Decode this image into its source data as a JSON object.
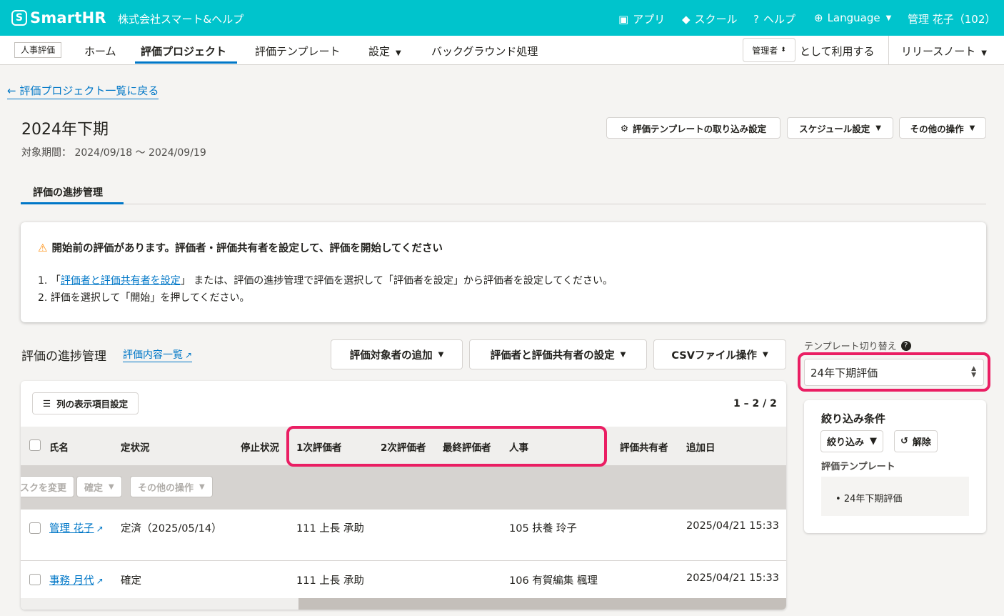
{
  "header": {
    "logo_mark": "S",
    "logo_text": "SmartHR",
    "company": "株式会社スマート&ヘルプ",
    "apps": "アプリ",
    "school": "スクール",
    "help": "ヘルプ",
    "language": "Language",
    "user": "管理 花子（102）"
  },
  "nav": {
    "badge": "人事評価",
    "home": "ホーム",
    "projects": "評価プロジェクト",
    "templates": "評価テンプレート",
    "settings": "設定",
    "background": "バックグラウンド処理",
    "role": "管理者",
    "role_suffix": "として利用する",
    "release_notes": "リリースノート"
  },
  "page": {
    "back_link": "評価プロジェクト一覧に戻る",
    "title": "2024年下期",
    "period_label": "対象期間：",
    "period_value": "2024/09/18 〜 2024/09/19",
    "btn_template_import": "評価テンプレートの取り込み設定",
    "btn_schedule": "スケジュール設定",
    "btn_other": "その他の操作",
    "tab": "評価の進捗管理"
  },
  "alert": {
    "title": "開始前の評価があります。評価者・評価共有者を設定して、評価を開始してください",
    "line1_prefix": "1. 「",
    "line1_link": "評価者と評価共有者を設定",
    "line1_suffix": "」 または、評価の進捗管理で評価を選択して「評価者を設定」から評価者を設定してください。",
    "line2": "2. 評価を選択して「開始」を押してください。"
  },
  "section": {
    "title": "評価の進捗管理",
    "link": "評価内容一覧",
    "btn_add": "評価対象者の追加",
    "btn_evaluators": "評価者と評価共有者の設定",
    "btn_csv": "CSVファイル操作",
    "template_label": "テンプレート切り替え",
    "template_value": "24年下期評価"
  },
  "table": {
    "columns_btn": "列の表示項目設定",
    "count": "1 – 2 / 2",
    "headers": [
      "氏名",
      "定状況",
      "停止状況",
      "1次評価者",
      "2次評価者",
      "最終評価者",
      "人事",
      "評価共有者",
      "追加日"
    ],
    "bulk": [
      "スクを変更",
      "確定",
      "その他の操作"
    ],
    "rows": [
      {
        "name": "管理 花子",
        "status": "定済（2025/05/14）",
        "eval1": "111 上長 承助",
        "hr": "105 扶養 玲子",
        "date": "2025/04/21 15:33"
      },
      {
        "name": "事務 月代",
        "status": "確定",
        "eval1": "111 上長 承助",
        "hr": "106 有賀編集 楓理",
        "date": "2025/04/21 15:33"
      }
    ]
  },
  "filter": {
    "title": "絞り込み条件",
    "btn_filter": "絞り込み",
    "btn_clear": "解除",
    "sub": "評価テンプレート",
    "item": "24年下期評価"
  },
  "colors": {
    "brand": "#00c4cc",
    "link": "#0077c7",
    "highlight": "#ea1e63",
    "warning": "#ff8800"
  }
}
